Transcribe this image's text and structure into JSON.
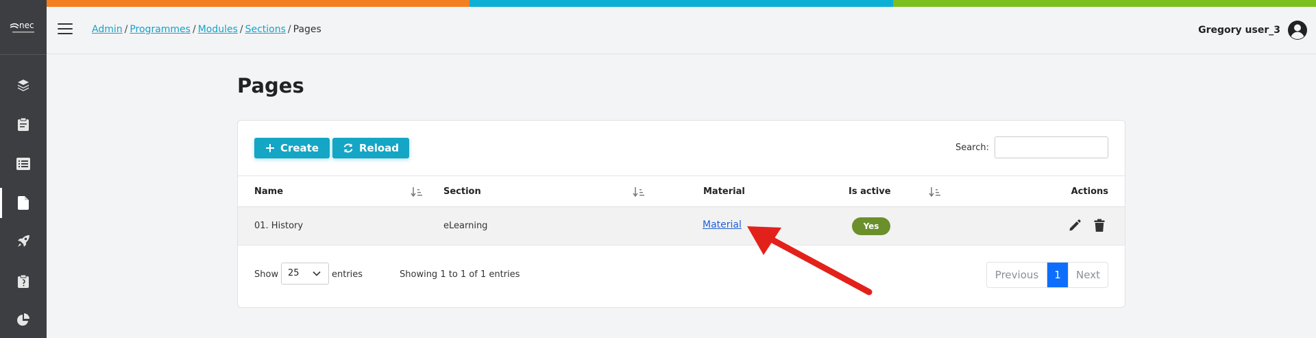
{
  "colors": {
    "orange": "#f47f20",
    "cyan": "#0bb0d4",
    "green": "#7cc01e",
    "accent": "#14a6c4",
    "badge": "#6a8f2b",
    "pager_active": "#0d6efd"
  },
  "logo": {
    "text": "nec"
  },
  "sidebar": {
    "items": [
      {
        "icon": "layers-icon"
      },
      {
        "icon": "clipboard-icon"
      },
      {
        "icon": "list-icon"
      },
      {
        "icon": "file-icon",
        "active": true
      },
      {
        "icon": "rocket-icon"
      },
      {
        "icon": "clipboard-check-icon"
      },
      {
        "icon": "pie-chart-icon"
      }
    ]
  },
  "breadcrumb": {
    "items": [
      "Admin",
      "Programmes",
      "Modules",
      "Sections"
    ],
    "current": "Pages"
  },
  "user": {
    "name": "Gregory user_3",
    "icon": "user-circle-icon"
  },
  "page": {
    "title": "Pages"
  },
  "toolbar": {
    "create_label": "Create",
    "reload_label": "Reload",
    "search_label": "Search:",
    "search_value": ""
  },
  "table": {
    "columns": [
      "Name",
      "Section",
      "Material",
      "Is active",
      "Actions"
    ],
    "rows": [
      {
        "name": "01. History",
        "section": "eLearning",
        "material": "Material",
        "is_active": "Yes"
      }
    ]
  },
  "footer": {
    "show_label": "Show",
    "page_length": "25",
    "entries_label": "entries",
    "info": "Showing 1 to 1 of 1 entries",
    "prev_label": "Previous",
    "current_page": "1",
    "next_label": "Next"
  }
}
